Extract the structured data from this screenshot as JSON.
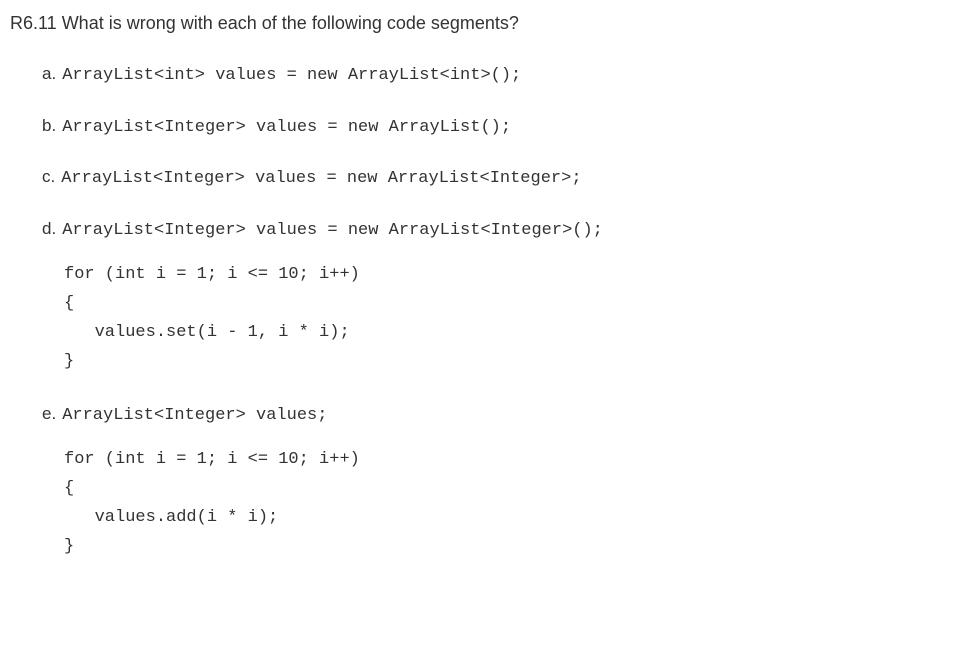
{
  "heading": "R6.11 What is wrong with each of the following code segments?",
  "items": {
    "a": {
      "label": "a.",
      "code": "ArrayList<int> values = new ArrayList<int>();"
    },
    "b": {
      "label": "b.",
      "code": "ArrayList<Integer> values = new ArrayList();"
    },
    "c": {
      "label": "c.",
      "code": "ArrayList<Integer> values = new ArrayList<Integer>;"
    },
    "d": {
      "label": "d.",
      "code": "ArrayList<Integer> values = new ArrayList<Integer>();",
      "block": "for (int i = 1; i <= 10; i++)\n{\n   values.set(i - 1, i * i);\n}"
    },
    "e": {
      "label": "e.",
      "code": "ArrayList<Integer> values;",
      "block": "for (int i = 1; i <= 10; i++)\n{\n   values.add(i * i);\n}"
    }
  }
}
